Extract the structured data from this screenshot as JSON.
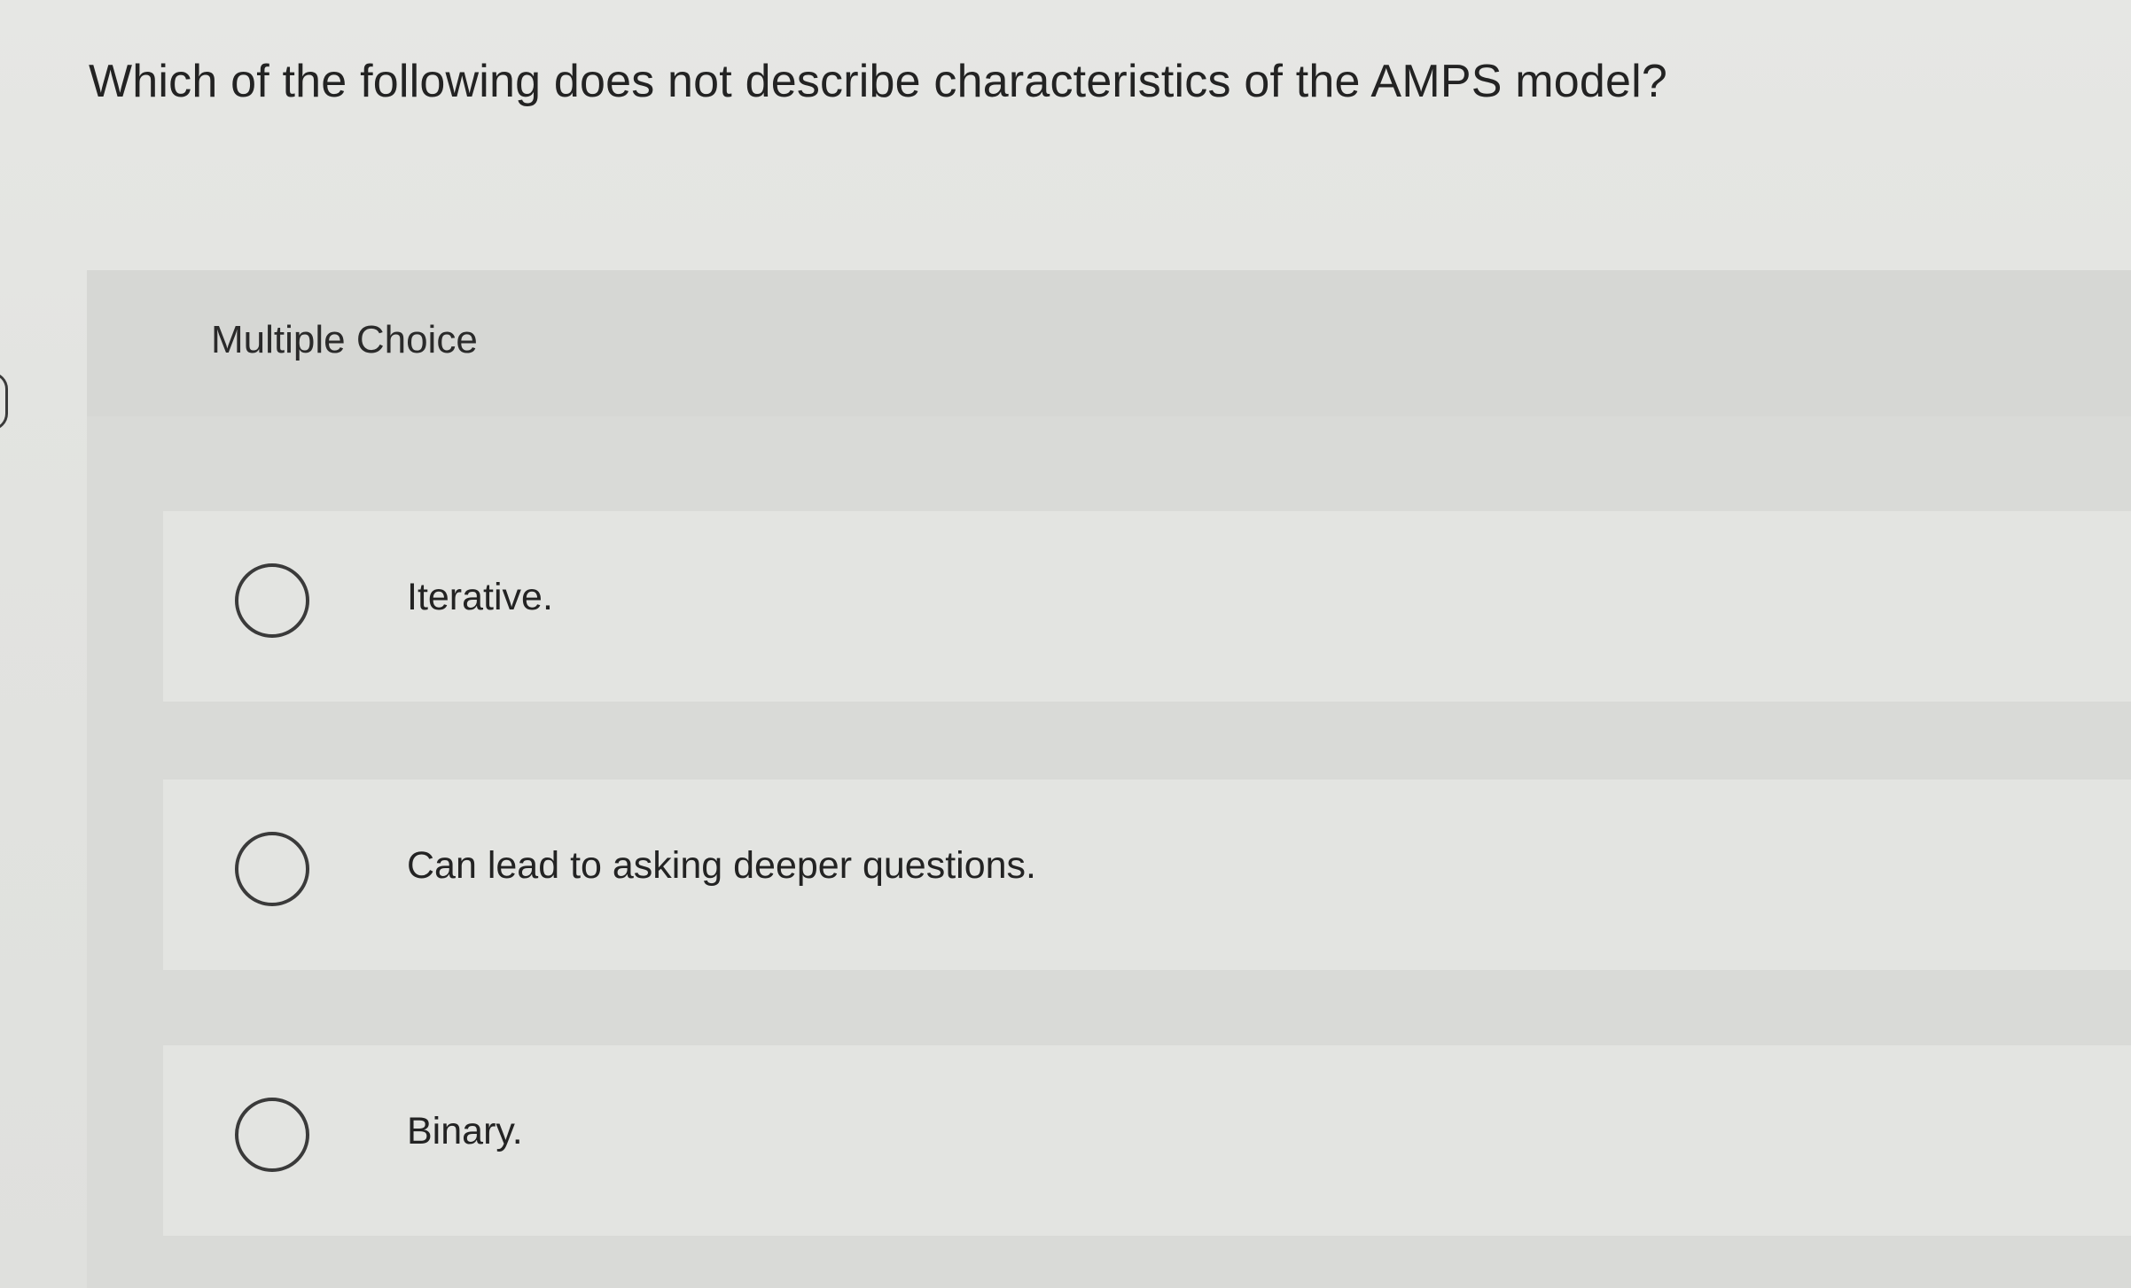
{
  "question": {
    "text": "Which of the following does not describe characteristics of the AMPS model?"
  },
  "panel": {
    "title": "Multiple Choice"
  },
  "options": [
    {
      "label": "Iterative."
    },
    {
      "label": "Can lead to asking deeper questions."
    },
    {
      "label": "Binary."
    }
  ]
}
